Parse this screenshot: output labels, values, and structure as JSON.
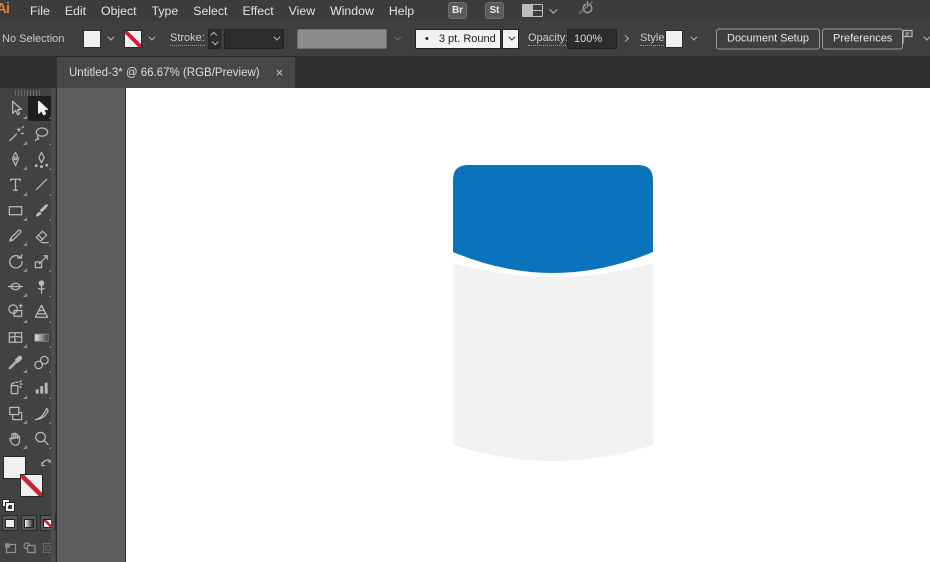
{
  "app": {
    "logo_text": "Ai"
  },
  "menu_bar": {
    "items": [
      "File",
      "Edit",
      "Object",
      "Type",
      "Select",
      "Effect",
      "View",
      "Window",
      "Help"
    ],
    "bridge_badge": "Br",
    "stock_badge": "St"
  },
  "control_bar": {
    "selection_status": "No Selection",
    "stroke_label": "Stroke:",
    "brush_bullet": "•",
    "brush_value": "3 pt. Round",
    "opacity_label": "Opacity:",
    "opacity_value": "100%",
    "style_label": "Style:",
    "document_setup_button": "Document Setup",
    "preferences_button": "Preferences"
  },
  "document_tab": {
    "title": "Untitled-3* @ 66.67% (RGB/Preview)",
    "close_glyph": "×"
  },
  "toolbar": {
    "tools": [
      {
        "name": "selection-tool",
        "icon": "arrow-hollow",
        "selected": false
      },
      {
        "name": "direct-selection-tool",
        "icon": "arrow-filled",
        "selected": true
      },
      {
        "name": "magic-wand-tool",
        "icon": "magic-wand",
        "selected": false
      },
      {
        "name": "lasso-tool",
        "icon": "lasso",
        "selected": false
      },
      {
        "name": "pen-tool",
        "icon": "pen-nib",
        "selected": false
      },
      {
        "name": "curvature-tool",
        "icon": "curvature-pen",
        "selected": false
      },
      {
        "name": "type-tool",
        "icon": "type-T",
        "selected": false
      },
      {
        "name": "line-segment-tool",
        "icon": "line",
        "selected": false
      },
      {
        "name": "rectangle-tool",
        "icon": "rectangle",
        "selected": false
      },
      {
        "name": "paintbrush-tool",
        "icon": "paintbrush",
        "selected": false
      },
      {
        "name": "pencil-tool",
        "icon": "pencil",
        "selected": false
      },
      {
        "name": "eraser-tool",
        "icon": "eraser",
        "selected": false
      },
      {
        "name": "rotate-tool",
        "icon": "rotate",
        "selected": false
      },
      {
        "name": "scale-tool",
        "icon": "scale",
        "selected": false
      },
      {
        "name": "width-tool",
        "icon": "width",
        "selected": false
      },
      {
        "name": "puppet-warp-tool",
        "icon": "pushpin",
        "selected": false
      },
      {
        "name": "shape-builder-tool",
        "icon": "shape-builder",
        "selected": false
      },
      {
        "name": "perspective-grid-tool",
        "icon": "perspective-grid",
        "selected": false
      },
      {
        "name": "mesh-tool",
        "icon": "mesh",
        "selected": false
      },
      {
        "name": "gradient-tool",
        "icon": "gradient",
        "selected": false
      },
      {
        "name": "eyedropper-tool",
        "icon": "eyedropper",
        "selected": false
      },
      {
        "name": "blend-tool",
        "icon": "blend",
        "selected": false
      },
      {
        "name": "symbol-sprayer-tool",
        "icon": "spray-can",
        "selected": false
      },
      {
        "name": "column-graph-tool",
        "icon": "bar-chart",
        "selected": false
      },
      {
        "name": "artboard-tool",
        "icon": "artboard",
        "selected": false
      },
      {
        "name": "slice-tool",
        "icon": "knife",
        "selected": false
      },
      {
        "name": "hand-tool",
        "icon": "hand",
        "selected": false
      },
      {
        "name": "zoom-tool",
        "icon": "magnifier",
        "selected": false
      }
    ]
  },
  "artwork": {
    "description": "jar shape: blue rounded cap over light gray cylinder body",
    "cap_color": "#0b73bb",
    "body_color": "#f2f2f2"
  },
  "colors": {
    "bar-bg": "#3c3c3c",
    "panel-bg": "#424242",
    "pasteboard": "#5e5e5e",
    "canvas-white": "#ffffff",
    "icon-gray": "#b9b9b9",
    "none-slash-red": "#cc2233"
  }
}
